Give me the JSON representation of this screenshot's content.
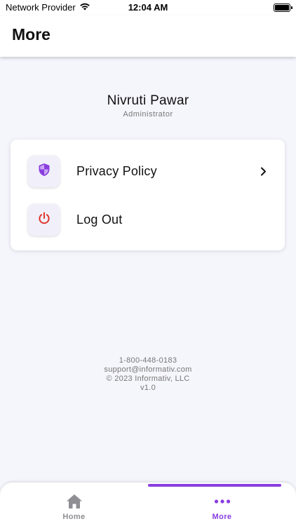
{
  "status_bar": {
    "carrier": "Network Provider",
    "time": "12:04 AM"
  },
  "header": {
    "title": "More"
  },
  "profile": {
    "name": "Nivruti Pawar",
    "role": "Administrator"
  },
  "menu": {
    "items": [
      {
        "label": "Privacy Policy",
        "icon": "shield-icon"
      },
      {
        "label": "Log Out",
        "icon": "power-icon"
      }
    ]
  },
  "footer": {
    "phone": "1-800-448-0183",
    "email": "support@informativ.com",
    "copyright": "© 2023 Informativ, LLC",
    "version": "v1.0"
  },
  "tabs": [
    {
      "label": "Home",
      "icon": "home-icon"
    },
    {
      "label": "More",
      "icon": "more-dots-icon"
    }
  ],
  "colors": {
    "accent": "#8a3ee0",
    "logout_red": "#e0322b",
    "background": "#f5f5fc"
  }
}
